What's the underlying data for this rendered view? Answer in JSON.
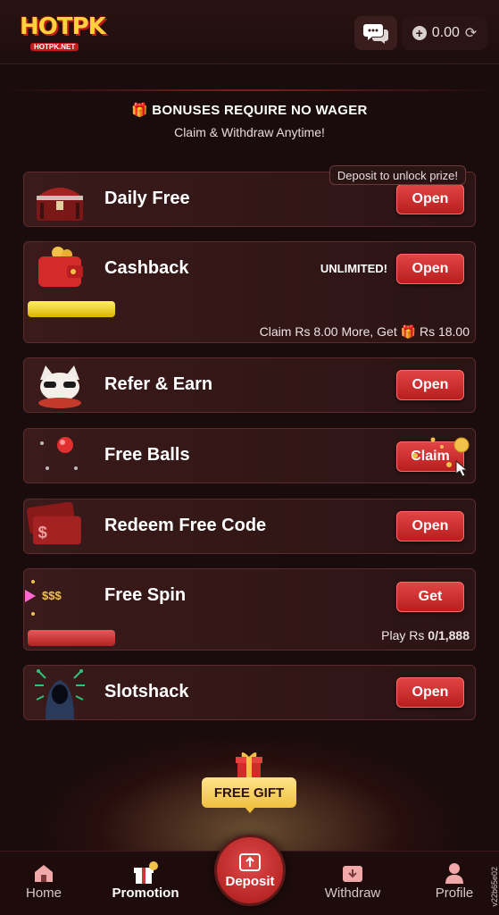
{
  "header": {
    "logo_main": "HOTPK",
    "logo_sub": "HOTPK.NET",
    "balance": "0.00"
  },
  "banner": {
    "title": "BONUSES REQUIRE NO WAGER",
    "subtitle": "Claim & Withdraw Anytime!"
  },
  "cards": {
    "daily_free": {
      "title": "Daily Free",
      "button": "Open",
      "tag": "Deposit to unlock prize!"
    },
    "cashback": {
      "title": "Cashback",
      "button": "Open",
      "badge": "UNLIMITED!",
      "footer_pre": "Claim Rs 8.00 More, Get",
      "footer_post": "Rs 18.00",
      "progress": 1.0
    },
    "refer": {
      "title": "Refer & Earn",
      "button": "Open"
    },
    "free_balls": {
      "title": "Free Balls",
      "button": "Claim"
    },
    "redeem": {
      "title": "Redeem Free Code",
      "button": "Open"
    },
    "free_spin": {
      "title": "Free Spin",
      "button": "Get",
      "label": "$$$",
      "footer_pre": "Play Rs",
      "footer_value": "0/1,888",
      "progress": 0
    },
    "slotshack": {
      "title": "Slotshack",
      "button": "Open"
    }
  },
  "free_gift": {
    "label": "FREE GIFT"
  },
  "nav": {
    "home": "Home",
    "promotion": "Promotion",
    "deposit": "Deposit",
    "withdraw": "Withdraw",
    "profile": "Profile"
  },
  "version": "v22b65e02",
  "colors": {
    "accent": "#d42a2a",
    "background": "#1a0c0c",
    "gold": "#f2c14a"
  }
}
